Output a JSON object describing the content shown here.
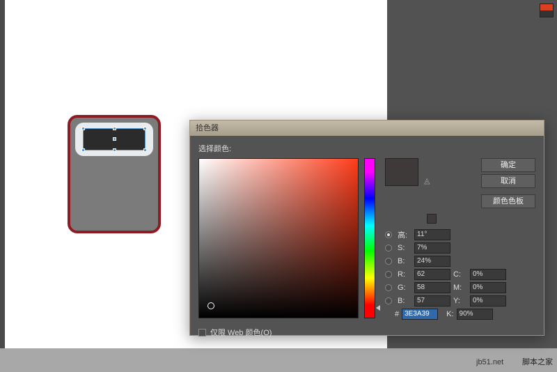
{
  "titlebar": "拾色器",
  "select_label": "选择颜色:",
  "buttons": {
    "ok": "确定",
    "cancel": "取消",
    "swatches": "颜色色板"
  },
  "hsb": {
    "h_label": "高:",
    "h_value": "11°",
    "s_label": "S:",
    "s_value": "7%",
    "b_label": "B:",
    "b_value": "24%"
  },
  "rgb": {
    "r_label": "R:",
    "r_value": "62",
    "g_label": "G:",
    "g_value": "58",
    "b_label": "B:",
    "b_value": "57"
  },
  "cmyk": {
    "c_label": "C:",
    "c_value": "0%",
    "m_label": "M:",
    "m_value": "0%",
    "y_label": "Y:",
    "y_value": "0%",
    "k_label": "K:",
    "k_value": "90%"
  },
  "hex_label": "#",
  "hex_value": "3E3A39",
  "web_only": "仅限 Web 颜色(O)",
  "footer_text": "脚本之家",
  "footer_url": "jb51.net"
}
